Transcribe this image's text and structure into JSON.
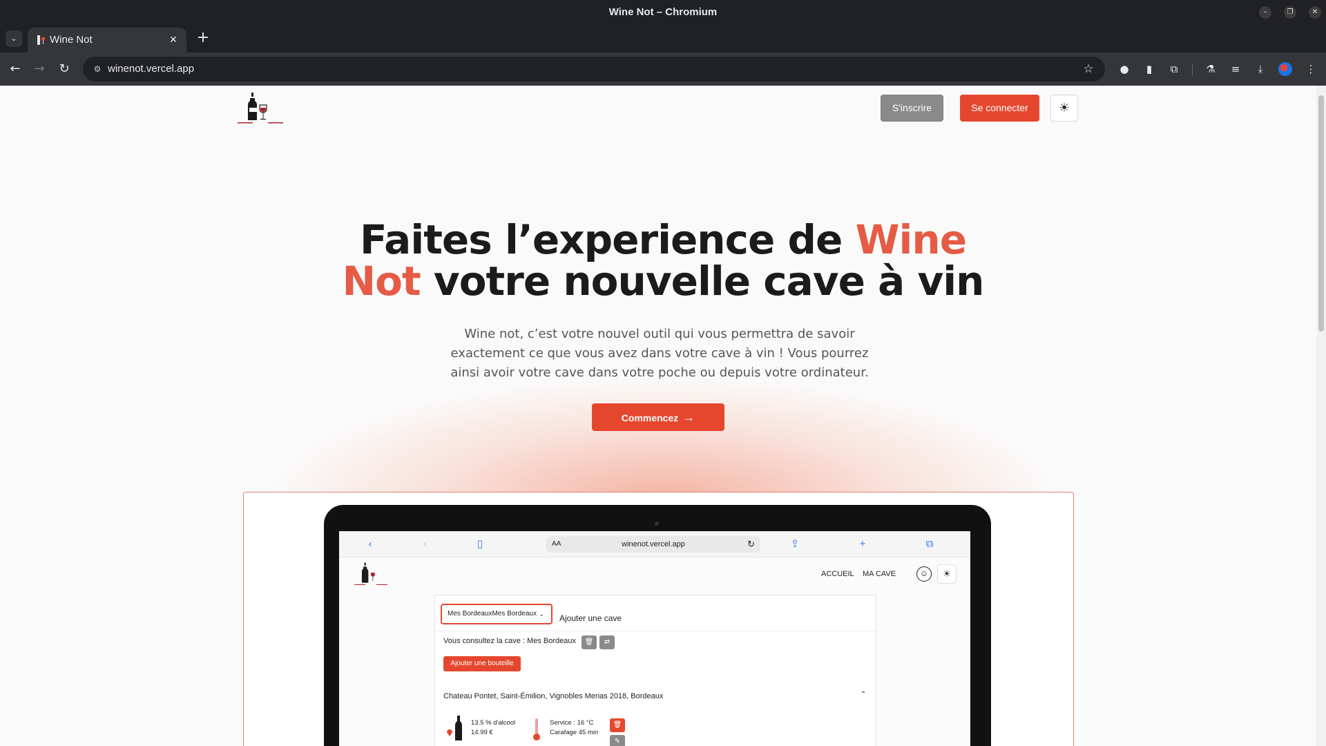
{
  "window": {
    "title": "Wine Not – Chromium"
  },
  "browser": {
    "tab": {
      "title": "Wine Not"
    },
    "address": {
      "url": "winenot.vercel.app"
    }
  },
  "site": {
    "nav": {
      "signup_label": "S'inscrire",
      "login_label": "Se connecter"
    },
    "hero": {
      "title_part1": "Faites l’experience de ",
      "title_accent1": "Wine",
      "title_accent2": "Not",
      "title_part2": " votre nouvelle cave à vin",
      "subtitle": "Wine not, c’est votre nouvel outil qui vous permettra de savoir exactement ce que vous avez dans votre cave à vin ! Vous pourrez ainsi avoir votre cave dans votre poche ou depuis votre ordinateur.",
      "cta_label": "Commencez"
    },
    "preview": {
      "safari": {
        "aa": "AA",
        "url": "winenot.vercel.app"
      },
      "nav": {
        "home": "ACCUEIL",
        "cellar": "MA CAVE"
      },
      "cave_select_value": "Mes BordeauxMes Bordeaux",
      "add_cave_label": "Ajouter une cave",
      "consulting_text": "Vous consultez la cave : Mes Bordeaux",
      "add_bottle_label": "Ajouter une bouteille",
      "wine": {
        "title": "Chateau Pontet, Saint-Émilion, Vignobles Merias 2018, Bordeaux",
        "alcohol": "13.5 % d'alcool",
        "price": "14.99 €",
        "service": "Service : 16 °C",
        "carafage": "Carafage 45 min"
      }
    }
  },
  "colors": {
    "accent": "#e5472e",
    "accent_text": "#e55b45",
    "secondary_button": "#8a8a8a",
    "page_bg": "#fafafa"
  },
  "icons": {
    "tab_favicon": "wine-glass-icon",
    "theme_toggle": "sun-icon",
    "cta": "arrow-right-icon"
  }
}
